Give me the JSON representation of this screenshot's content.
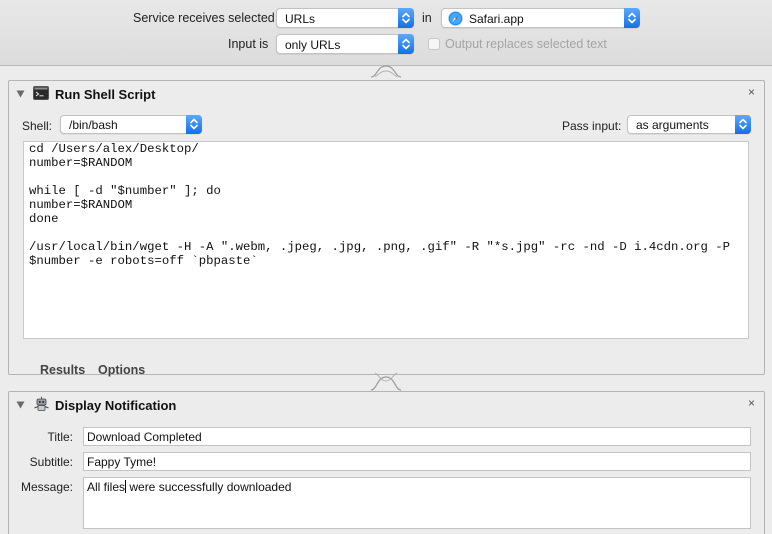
{
  "service": {
    "receives_label": "Service receives selected",
    "receives_value": "URLs",
    "in_label": "in",
    "app_value": "Safari.app",
    "input_label": "Input is",
    "input_value": "only URLs",
    "output_replaces_label": "Output replaces selected text",
    "output_replaces_checked": false
  },
  "run_shell": {
    "title": "Run Shell Script",
    "close": "×",
    "shell_label": "Shell:",
    "shell_value": "/bin/bash",
    "pass_input_label": "Pass input:",
    "pass_input_value": "as arguments",
    "script": "cd /Users/alex/Desktop/\nnumber=$RANDOM\n\nwhile [ -d \"$number\" ]; do\nnumber=$RANDOM\ndone\n\n/usr/local/bin/wget -H -A \".webm, .jpeg, .jpg, .png, .gif\" -R \"*s.jpg\" -rc -nd -D i.4cdn.org -P\n$number -e robots=off `pbpaste`",
    "results_tab": "Results",
    "options_tab": "Options"
  },
  "notification": {
    "title": "Display Notification",
    "close": "×",
    "title_label": "Title:",
    "title_value": "Download Completed",
    "subtitle_label": "Subtitle:",
    "subtitle_value": "Fappy Tyme!",
    "message_label": "Message:",
    "message_before_cursor": "All files",
    "message_after_cursor": " were successfully downloaded"
  }
}
